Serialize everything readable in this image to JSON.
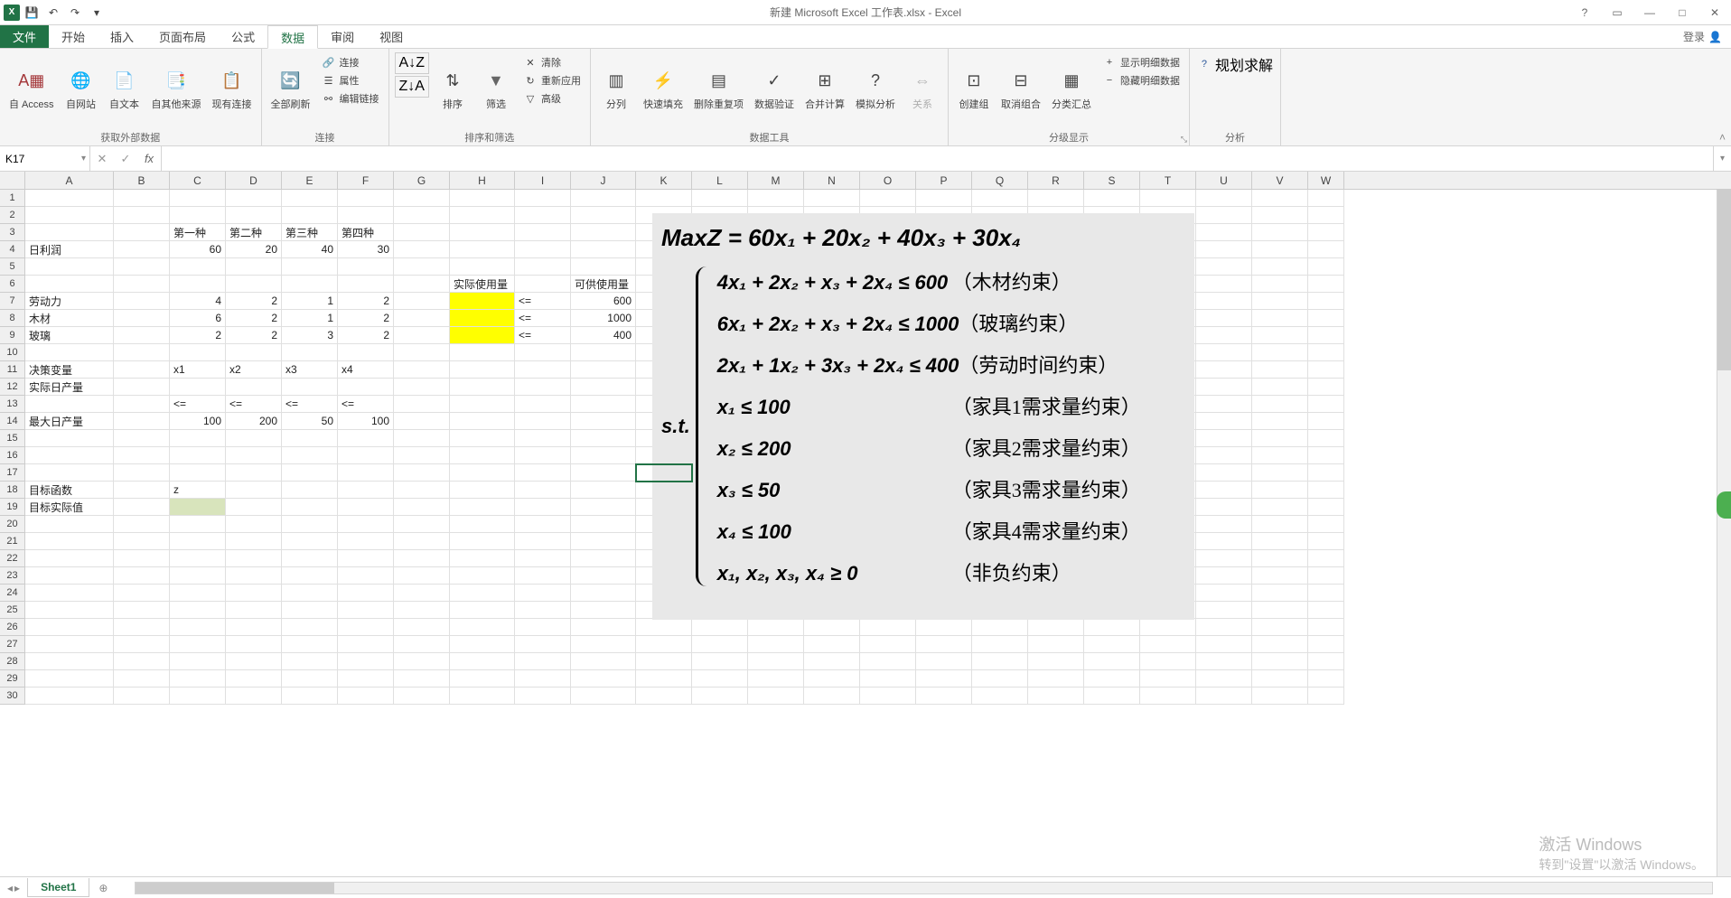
{
  "title": "新建 Microsoft Excel 工作表.xlsx - Excel",
  "qat": {
    "save": "💾",
    "undo": "↶",
    "redo": "↷",
    "more": "▾"
  },
  "win": {
    "help": "?",
    "ribbon_opts": "▭",
    "min": "—",
    "max": "□",
    "close": "✕"
  },
  "login": "登录",
  "menu": {
    "file": "文件",
    "home": "开始",
    "insert": "插入",
    "layout": "页面布局",
    "formulas": "公式",
    "data": "数据",
    "review": "审阅",
    "view": "视图"
  },
  "ribbon": {
    "ext": {
      "access": "自 Access",
      "web": "自网站",
      "text": "自文本",
      "other": "自其他来源",
      "existing": "现有连接",
      "label": "获取外部数据"
    },
    "conn": {
      "refresh": "全部刷新",
      "connections": "连接",
      "properties": "属性",
      "editlinks": "编辑链接",
      "label": "连接"
    },
    "sort": {
      "az": "A↓Z",
      "za": "Z↓A",
      "sort": "排序",
      "filter": "筛选",
      "clear": "清除",
      "reapply": "重新应用",
      "adv": "高级",
      "label": "排序和筛选"
    },
    "tools": {
      "t2c": "分列",
      "flash": "快速填充",
      "dup": "删除重复项",
      "valid": "数据验证",
      "consol": "合并计算",
      "whatif": "模拟分析",
      "rel": "关系",
      "label": "数据工具"
    },
    "outline": {
      "group": "创建组",
      "ungroup": "取消组合",
      "subtotal": "分类汇总",
      "showdet": "显示明细数据",
      "hidedet": "隐藏明细数据",
      "label": "分级显示"
    },
    "analysis": {
      "solver": "规划求解",
      "label": "分析"
    }
  },
  "namebox": "K17",
  "fx": "fx",
  "cols": [
    "A",
    "B",
    "C",
    "D",
    "E",
    "F",
    "G",
    "H",
    "I",
    "J",
    "K",
    "L",
    "M",
    "N",
    "O",
    "P",
    "Q",
    "R",
    "S",
    "T",
    "U",
    "V",
    "W"
  ],
  "cells": {
    "r3": {
      "C": "第一种",
      "D": "第二种",
      "E": "第三种",
      "F": "第四种"
    },
    "r4": {
      "A": "日利润",
      "C": "60",
      "D": "20",
      "E": "40",
      "F": "30"
    },
    "r6": {
      "H": "实际使用量",
      "J": "可供使用量"
    },
    "r7": {
      "A": "劳动力",
      "C": "4",
      "D": "2",
      "E": "1",
      "F": "2",
      "I": "<=",
      "J": "600"
    },
    "r8": {
      "A": "木材",
      "C": "6",
      "D": "2",
      "E": "1",
      "F": "2",
      "I": "<=",
      "J": "1000"
    },
    "r9": {
      "A": "玻璃",
      "C": "2",
      "D": "2",
      "E": "3",
      "F": "2",
      "I": "<=",
      "J": "400"
    },
    "r11": {
      "A": "决策变量",
      "C": "x1",
      "D": "x2",
      "E": "x3",
      "F": "x4"
    },
    "r12": {
      "A": "实际日产量"
    },
    "r13": {
      "C": "<=",
      "D": "<=",
      "E": "<=",
      "F": "<="
    },
    "r14": {
      "A": "最大日产量",
      "C": "100",
      "D": "200",
      "E": "50",
      "F": "100"
    },
    "r18": {
      "A": "目标函数",
      "C": "z"
    },
    "r19": {
      "A": "目标实际值"
    }
  },
  "overlay": {
    "maxz_l": "MaxZ",
    "maxz_r": " = 60x₁ + 20x₂ + 40x₃ + 30x₄",
    "st": "s.t.",
    "c1e": "4x₁ + 2x₂ + x₃ + 2x₄ ≤ 600",
    "c1d": "（木材约束）",
    "c2e": "6x₁ + 2x₂ + x₃ + 2x₄ ≤ 1000",
    "c2d": "（玻璃约束）",
    "c3e": "2x₁ + 1x₂ + 3x₃ + 2x₄ ≤ 400",
    "c3d": "（劳动时间约束）",
    "c4e": "x₁ ≤ 100",
    "c4d": "（家具1需求量约束）",
    "c5e": "x₂ ≤ 200",
    "c5d": "（家具2需求量约束）",
    "c6e": "x₃ ≤ 50",
    "c6d": "（家具3需求量约束）",
    "c7e": "x₄ ≤ 100",
    "c7d": "（家具4需求量约束）",
    "c8e": "x₁, x₂, x₃, x₄ ≥ 0",
    "c8d": "（非负约束）"
  },
  "sheet": {
    "name": "Sheet1",
    "add": "⊕"
  },
  "watermark": {
    "l1": "激活 Windows",
    "l2": "转到\"设置\"以激活 Windows。"
  }
}
